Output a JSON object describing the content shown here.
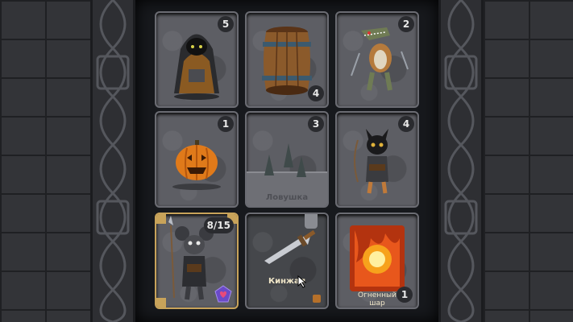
{
  "cards": [
    {
      "id": "rogue-hooded",
      "badge": "5",
      "art": "hooded-rogue-icon"
    },
    {
      "id": "barrel",
      "badge": "4",
      "art": "barrel-icon"
    },
    {
      "id": "lizard-warrior",
      "badge": "2",
      "art": "lizard-warrior-icon"
    },
    {
      "id": "pumpkin",
      "badge": "1",
      "art": "pumpkin-icon"
    },
    {
      "id": "trap",
      "badge": "3",
      "label": "Ловушка",
      "art": "spike-trap-icon"
    },
    {
      "id": "black-cat",
      "badge": "4",
      "art": "black-cat-archer-icon"
    },
    {
      "id": "hero-mouse",
      "health": "8/15",
      "art": "mouse-knight-icon",
      "gem": "heart-gem-icon"
    },
    {
      "id": "dagger",
      "label": "Кинжал",
      "art": "dagger-icon"
    },
    {
      "id": "fireball",
      "label_line1": "Огненный",
      "label_line2": "шар",
      "count": "1",
      "art": "fireball-icon"
    }
  ],
  "colors": {
    "card": "#5d5e64",
    "board": "#17191d",
    "gold": "#c8a35a",
    "fire": "#e8571c"
  }
}
